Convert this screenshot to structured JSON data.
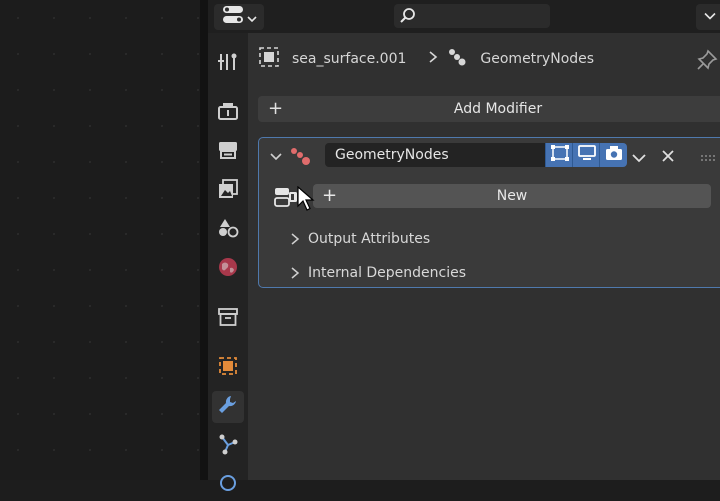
{
  "header": {
    "editor_type_icon": "properties-editor-icon",
    "search": {
      "icon": "search-icon",
      "value": ""
    }
  },
  "tabs": [
    {
      "name": "tool",
      "icon": "tool-icon",
      "active": false
    },
    {
      "name": "render",
      "icon": "render-icon",
      "active": false
    },
    {
      "name": "output",
      "icon": "output-icon",
      "active": false
    },
    {
      "name": "view-layer",
      "icon": "view-layer-icon",
      "active": false
    },
    {
      "name": "scene",
      "icon": "scene-icon",
      "active": false
    },
    {
      "name": "world",
      "icon": "world-icon",
      "active": false
    },
    {
      "name": "collection",
      "icon": "collection-icon",
      "active": false
    },
    {
      "name": "object",
      "icon": "object-icon",
      "active": false
    },
    {
      "name": "modifiers",
      "icon": "wrench-icon",
      "active": true
    },
    {
      "name": "particles",
      "icon": "particles-icon",
      "active": false
    }
  ],
  "breadcrumb": {
    "object_name": "sea_surface.001",
    "separator": ">",
    "modifier_name": "GeometryNodes"
  },
  "add_modifier": {
    "label": "Add Modifier",
    "plus": "+"
  },
  "modifier": {
    "name": "GeometryNodes",
    "toggles": [
      "edit-mode-icon",
      "realtime-icon",
      "render-camera-icon"
    ],
    "new_button": {
      "label": "New",
      "plus": "+"
    },
    "subpanels": [
      {
        "label": "Output Attributes"
      },
      {
        "label": "Internal Dependencies"
      }
    ]
  },
  "colors": {
    "accent": "#4673b3",
    "panel_bg": "#303030",
    "modifier_bg": "#3a3a3a",
    "modifier_border": "#4f79ad",
    "geometry_nodes_icon": "#e06c6c"
  }
}
